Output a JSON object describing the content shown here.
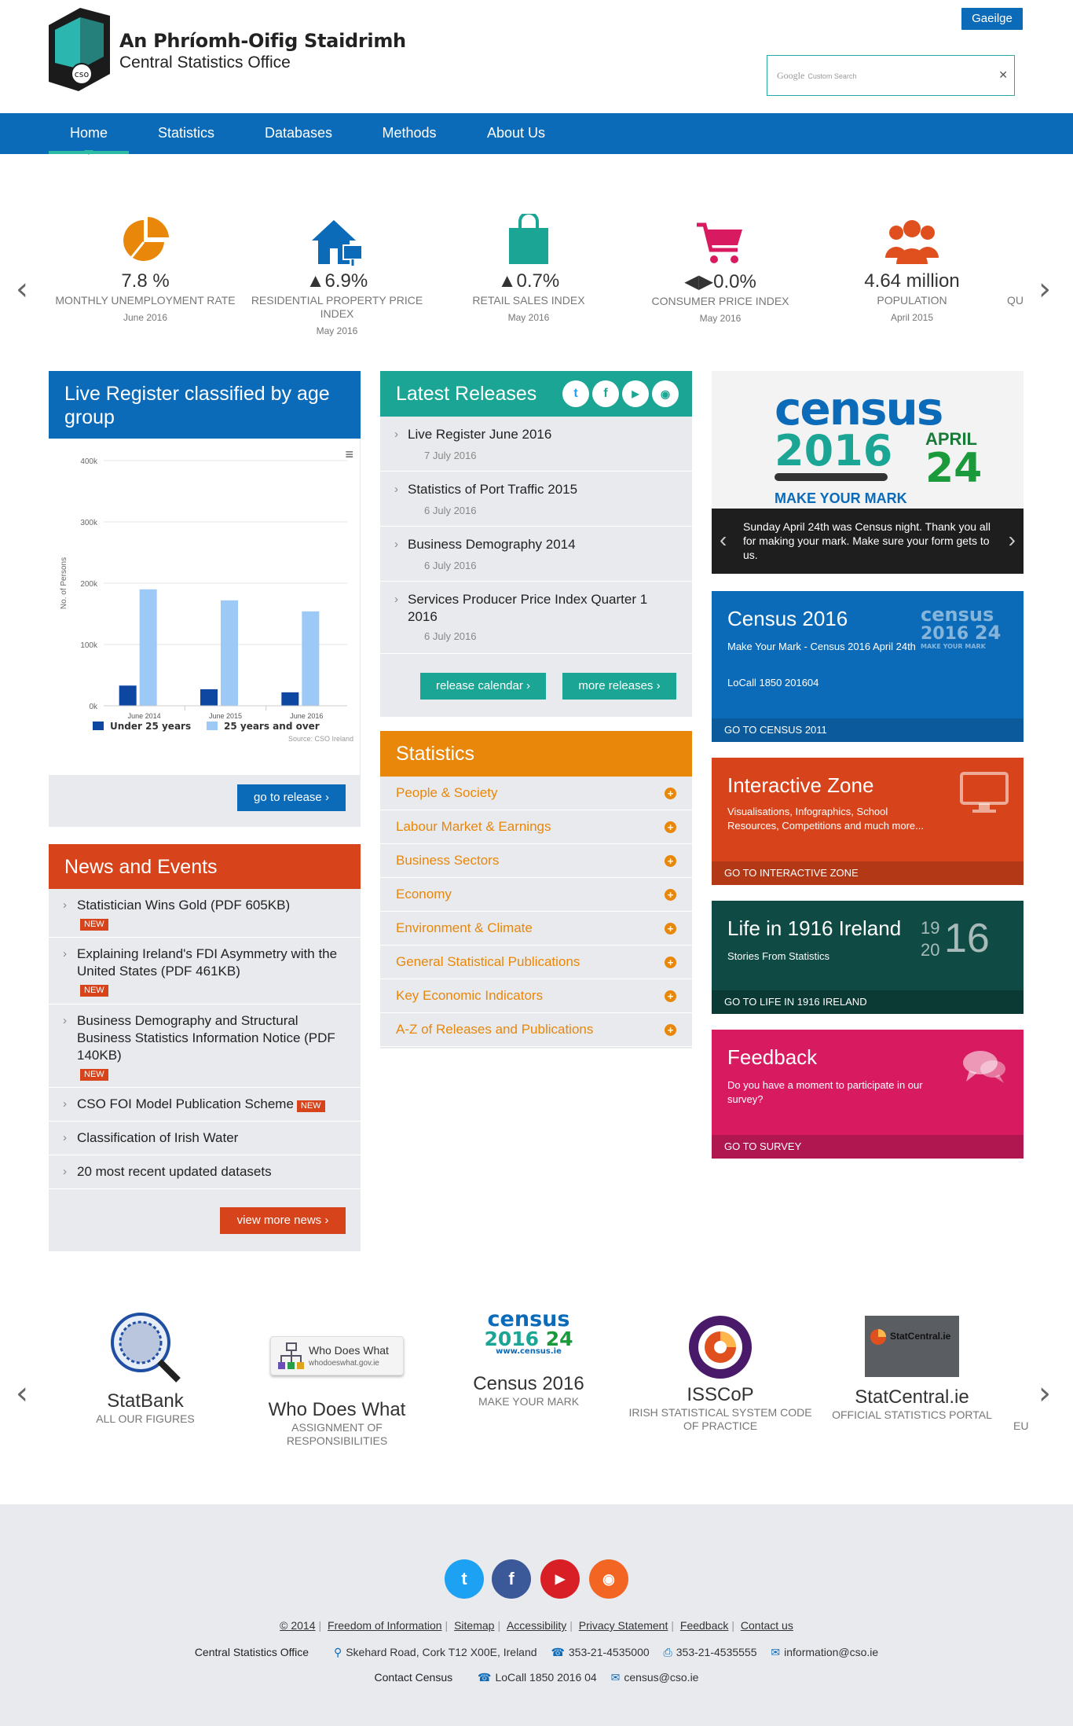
{
  "header": {
    "brand_irish": "An Phríomh-Oifig Staidrimh",
    "brand_english": "Central Statistics Office",
    "logo_text": "cso",
    "language_button": "Gaeilge",
    "search": {
      "google_label": "Google",
      "search_hint": "Custom Search",
      "clear_icon": "✕"
    }
  },
  "nav": {
    "items": [
      {
        "label": "Home",
        "active": true
      },
      {
        "label": "Statistics"
      },
      {
        "label": "Databases"
      },
      {
        "label": "Methods"
      },
      {
        "label": "About Us"
      }
    ]
  },
  "stats_carousel": {
    "prev": "‹",
    "next": "›",
    "items": [
      {
        "value": "7.8 %",
        "label": "MONTHLY UNEMPLOYMENT RATE",
        "date": "June 2016",
        "icon": "pie-chart-icon",
        "color": "#e8870a"
      },
      {
        "value": "▲6.9%",
        "label": "RESIDENTIAL PROPERTY PRICE INDEX",
        "date": "May 2016",
        "icon": "house-for-sale-icon",
        "color": "#0c6bb8"
      },
      {
        "value": "▲0.7%",
        "label": "RETAIL SALES INDEX",
        "date": "May 2016",
        "icon": "shopping-bag-icon",
        "color": "#1aa595"
      },
      {
        "value": "◀▶0.0%",
        "label": "CONSUMER PRICE INDEX",
        "date": "May 2016",
        "icon": "shopping-cart-icon",
        "color": "#d81b60"
      },
      {
        "value": "4.64 million",
        "label": "POPULATION",
        "date": "April 2015",
        "icon": "people-icon",
        "color": "#e0501e"
      },
      {
        "value": "",
        "label": "QU",
        "date": "",
        "icon": "",
        "color": ""
      }
    ]
  },
  "live_register": {
    "title": "Live Register classified by age group",
    "button": "go to release",
    "menu_icon": "≡"
  },
  "chart_data": {
    "type": "bar",
    "categories": [
      "June 2014",
      "June 2015",
      "June 2016"
    ],
    "series": [
      {
        "name": "Under 25 years",
        "values": [
          33000,
          27000,
          22000
        ],
        "color": "#0d47a1"
      },
      {
        "name": "25 years and over",
        "values": [
          190000,
          172000,
          154000
        ],
        "color": "#9cc9f5"
      }
    ],
    "ylabel": "No. of Persons",
    "ylim": [
      0,
      400000
    ],
    "yticks": [
      "0k",
      "100k",
      "200k",
      "300k",
      "400k"
    ],
    "source": "Source: CSO Ireland",
    "legend": "bottom"
  },
  "latest_releases": {
    "title": "Latest Releases",
    "social": [
      "twitter-icon",
      "facebook-icon",
      "youtube-icon",
      "rss-icon"
    ],
    "items": [
      {
        "title": "Live Register June 2016",
        "date": "7 July 2016"
      },
      {
        "title": "Statistics of Port Traffic 2015",
        "date": "6 July 2016"
      },
      {
        "title": "Business Demography 2014",
        "date": "6 July 2016"
      },
      {
        "title": "Services Producer Price Index Quarter 1 2016",
        "date": "6 July 2016"
      }
    ],
    "calendar_button": "release calendar",
    "more_button": "more releases"
  },
  "news": {
    "title": "News and Events",
    "items": [
      {
        "title": "Statistician Wins Gold (PDF 605KB)",
        "badge": "NEW"
      },
      {
        "title": "Explaining Ireland's FDI Asymmetry with the United States (PDF 461KB)",
        "badge": "NEW"
      },
      {
        "title": "Business Demography and Structural Business Statistics Information Notice (PDF 140KB)",
        "badge": "NEW"
      },
      {
        "title": "CSO FOI Model Publication Scheme",
        "badge": "NEW"
      },
      {
        "title": "Classification of Irish Water",
        "badge": ""
      },
      {
        "title": "20 most recent updated datasets",
        "badge": ""
      }
    ],
    "more_button": "view more news"
  },
  "statistics": {
    "title": "Statistics",
    "items": [
      "People & Society",
      "Labour Market & Earnings",
      "Business Sectors",
      "Economy",
      "Environment & Climate",
      "General Statistical Publications",
      "Key Economic Indicators",
      "A-Z of Releases and Publications"
    ]
  },
  "census_slider": {
    "logo_word": "census",
    "logo_year": "2016",
    "logo_month": "APRIL",
    "logo_day": "24",
    "logo_tag": "MAKE YOUR MARK",
    "caption": "Sunday April 24th was Census night. Thank you all for making your mark. Make sure your form gets to us.",
    "prev": "‹",
    "next": "›"
  },
  "side_cards": [
    {
      "title": "Census 2016",
      "desc": "Make Your Mark - Census 2016 April 24th",
      "desc2": "LoCall 1850 201604",
      "go": "GO TO CENSUS 2011",
      "color": "#0c6bb8",
      "go_color": "#0a5a9c"
    },
    {
      "title": "Interactive Zone",
      "desc": "Visualisations, Infographics, School Resources, Competitions and much more...",
      "desc2": "",
      "go": "GO TO INTERACTIVE ZONE",
      "color": "#d7431a",
      "go_color": "#b33816"
    },
    {
      "title": "Life in 1916 Ireland",
      "desc": "Stories From Statistics",
      "desc2": "",
      "go": "GO TO LIFE IN 1916 IRELAND",
      "color": "#0f4a44",
      "go_color": "#0b3a35",
      "emblem_top": "19",
      "emblem_bottom": "20",
      "emblem_big": "16"
    },
    {
      "title": "Feedback",
      "desc": "Do you have a moment to participate in our survey?",
      "desc2": "",
      "go": "GO TO SURVEY",
      "color": "#d81b60",
      "go_color": "#b0164f"
    }
  ],
  "partners": {
    "prev": "‹",
    "next": "›",
    "items": [
      {
        "name": "StatBank",
        "sub": "ALL OUR FIGURES"
      },
      {
        "name": "Who Does What",
        "sub": "ASSIGNMENT OF RESPONSIBILITIES",
        "logo_title": "Who Does What",
        "logo_url": "whodoeswhat.gov.ie"
      },
      {
        "name": "Census 2016",
        "sub": "MAKE YOUR MARK",
        "logo_url": "www.census.ie"
      },
      {
        "name": "ISSCoP",
        "sub": "IRISH STATISTICAL SYSTEM CODE OF PRACTICE"
      },
      {
        "name": "StatCentral.ie",
        "sub": "OFFICIAL STATISTICS PORTAL",
        "logo_title": "StatCentral.ie"
      },
      {
        "name": "",
        "sub": "EU"
      }
    ]
  },
  "footer": {
    "social": [
      {
        "icon": "twitter-icon",
        "glyph": "t",
        "color": "#1da1f2"
      },
      {
        "icon": "facebook-icon",
        "glyph": "f",
        "color": "#3b5998"
      },
      {
        "icon": "youtube-icon",
        "glyph": "▶",
        "color": "#d91f26"
      },
      {
        "icon": "rss-icon",
        "glyph": "◉",
        "color": "#f26522"
      }
    ],
    "links": [
      "© 2014",
      "Freedom of Information",
      "Sitemap",
      "Accessibility",
      "Privacy Statement",
      "Feedback",
      "Contact us"
    ],
    "org": "Central Statistics Office",
    "address": "Skehard Road, Cork T12 X00E, Ireland",
    "phone": "353-21-4535000",
    "fax": "353-21-4535555",
    "email": "information@cso.ie",
    "census_label": "Contact Census",
    "census_phone": "LoCall 1850 2016 04",
    "census_email": "census@cso.ie"
  }
}
